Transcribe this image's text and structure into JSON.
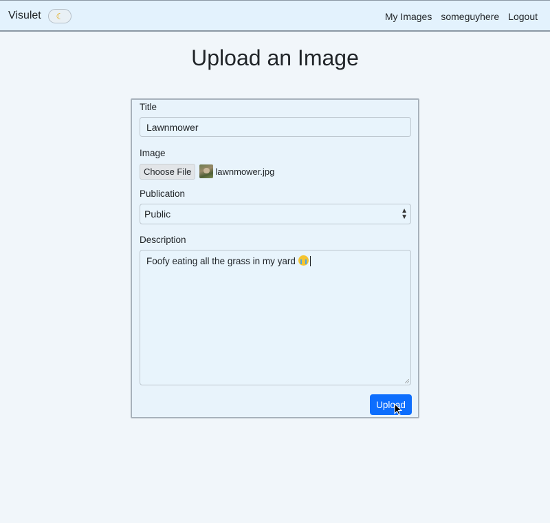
{
  "navbar": {
    "brand": "Visulet",
    "theme_toggle_icon": "moon-icon",
    "links": [
      "My Images",
      "someguyhere",
      "Logout"
    ]
  },
  "page": {
    "title": "Upload an Image"
  },
  "form": {
    "title_label": "Title",
    "title_value": "Lawnmower",
    "image_label": "Image",
    "choose_file_label": "Choose File",
    "file_name": "lawnmower.jpg",
    "publication_label": "Publication",
    "publication_value": "Public",
    "description_label": "Description",
    "description_value": "Foofy eating all the grass in my yard",
    "submit_label": "Upload"
  },
  "colors": {
    "navbar_bg": "#e3f2fd",
    "page_bg": "#f1f6fa",
    "primary": "#0d6efd"
  }
}
